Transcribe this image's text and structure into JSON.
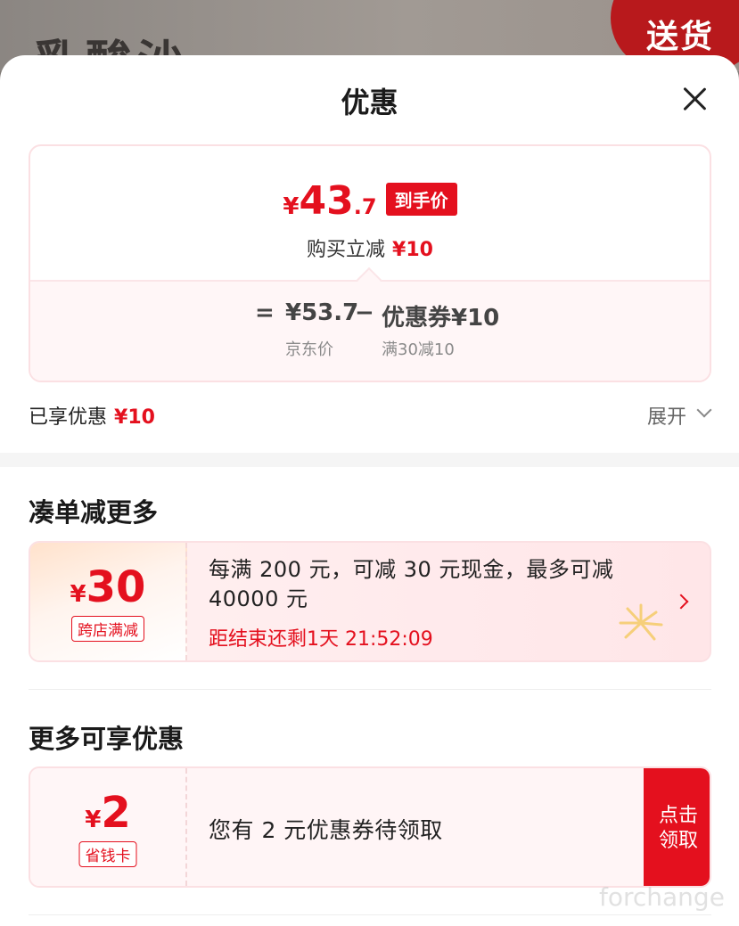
{
  "background": {
    "partial_title": "乳酸沙",
    "badge_text": "送货"
  },
  "sheet": {
    "title": "优惠"
  },
  "price_card": {
    "currency": "¥",
    "price_integer": "43",
    "price_decimal": ".7",
    "price_tag": "到手价",
    "instant_reduce_label": "购买立减",
    "instant_reduce_value": "¥10",
    "equals": "=",
    "jd_price": "¥53.7",
    "minus": "−",
    "coupon_label": "优惠券¥10",
    "jd_price_label": "京东价",
    "coupon_condition": "满30减10"
  },
  "summary": {
    "enjoyed_label": "已享优惠",
    "enjoyed_value": "¥10",
    "expand_label": "展开"
  },
  "section_more_reduce": {
    "title": "凑单减更多",
    "card": {
      "currency": "¥",
      "amount": "30",
      "type_label": "跨店满减",
      "description": "每满 200 元，可减 30 元现金，最多可减 40000 元",
      "countdown": "距结束还剩1天 21:52:09"
    }
  },
  "section_more_offers": {
    "title": "更多可享优惠",
    "card": {
      "currency": "¥",
      "amount": "2",
      "type_label": "省钱卡",
      "description": "您有 2 元优惠券待领取",
      "claim_label_line1": "点击",
      "claim_label_line2": "领取"
    }
  },
  "watermark": "forchange",
  "colors": {
    "accent_red": "#e4101e",
    "card_border": "#fbe0e3"
  }
}
